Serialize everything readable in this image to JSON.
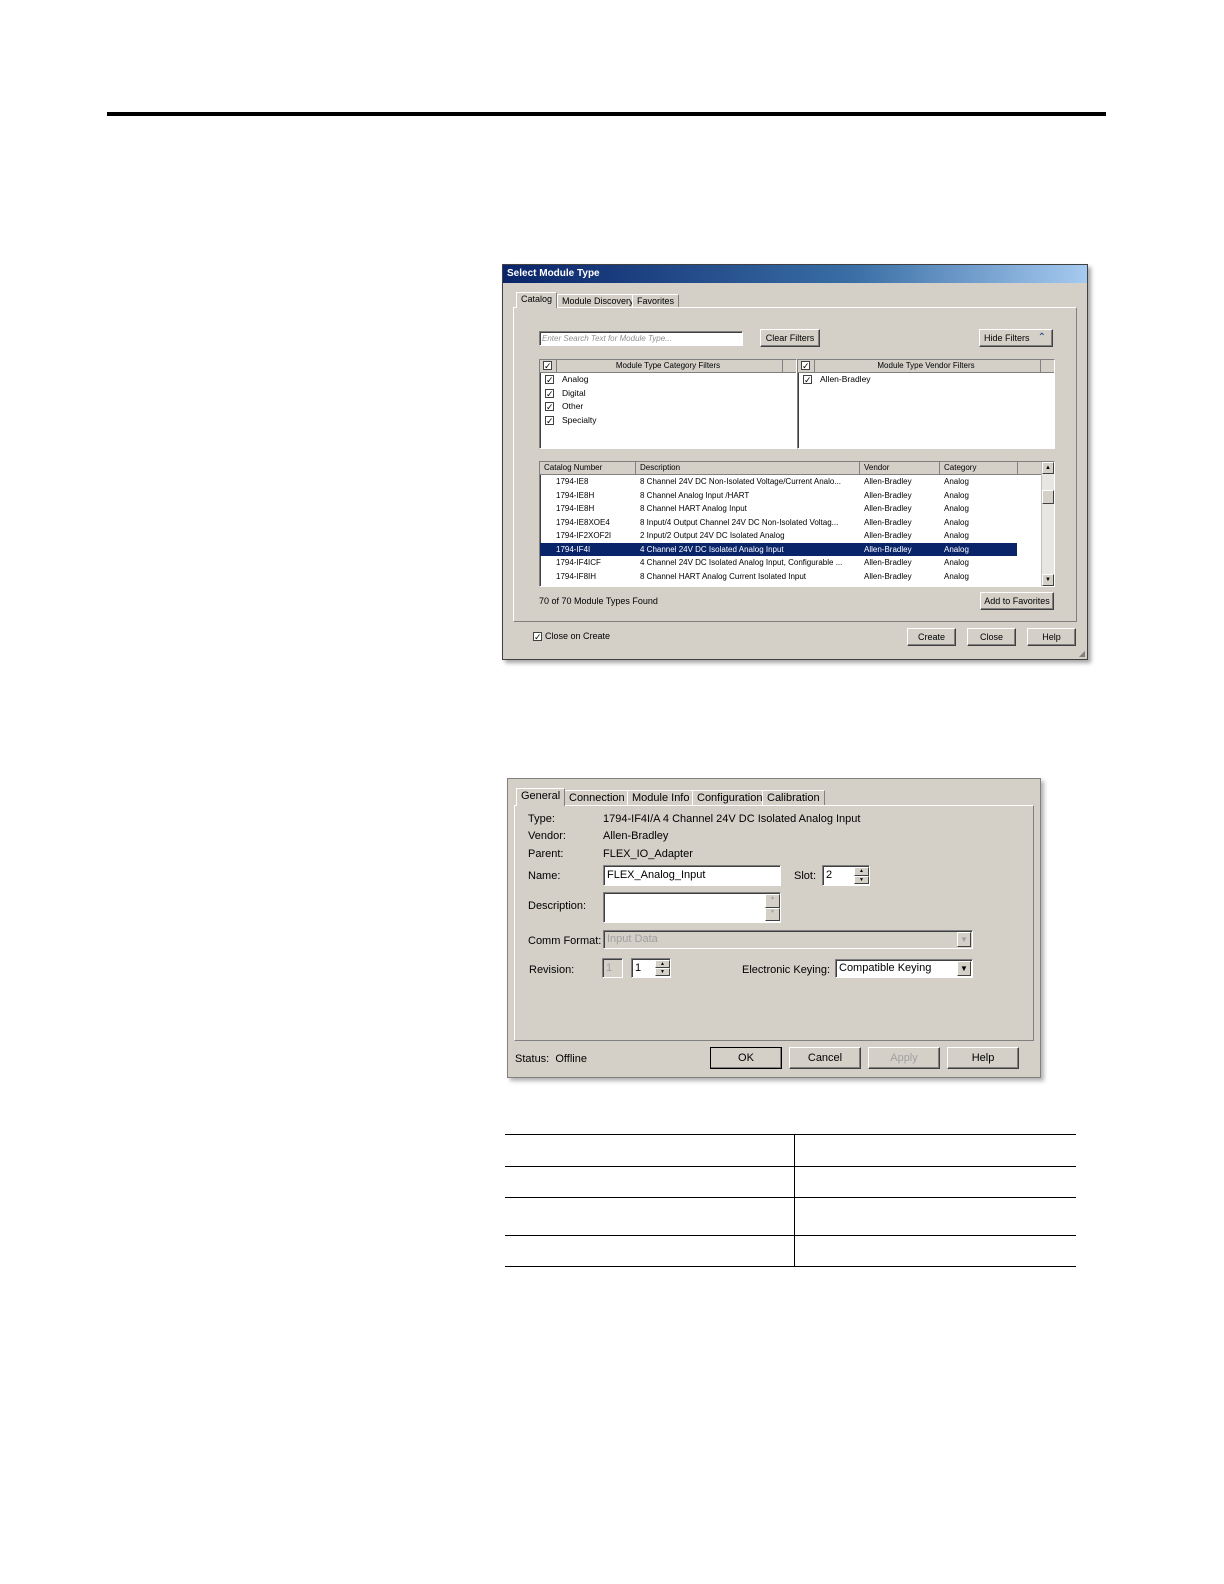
{
  "select_module_dialog": {
    "title": "Select Module Type",
    "tabs": [
      "Catalog",
      "Module Discovery",
      "Favorites"
    ],
    "search": {
      "placeholder": "Enter Search Text for Module Type..."
    },
    "clear_filters_label": "Clear Filters",
    "hide_filters_label": "Hide Filters",
    "category_filters": {
      "header": "Module Type Category Filters",
      "all_checked": true,
      "items": [
        {
          "label": "Analog",
          "checked": true
        },
        {
          "label": "Digital",
          "checked": true
        },
        {
          "label": "Other",
          "checked": true
        },
        {
          "label": "Specialty",
          "checked": true
        }
      ]
    },
    "vendor_filters": {
      "header": "Module Type Vendor Filters",
      "all_checked": true,
      "items": [
        {
          "label": "Allen-Bradley",
          "checked": true
        }
      ]
    },
    "columns": [
      "Catalog Number",
      "Description",
      "Vendor",
      "Category"
    ],
    "rows": [
      {
        "catalog": "1794-IE8",
        "description": "8 Channel 24V DC Non-Isolated Voltage/Current Analo...",
        "vendor": "Allen-Bradley",
        "category": "Analog"
      },
      {
        "catalog": "1794-IE8H",
        "description": "8 Channel Analog Input /HART",
        "vendor": "Allen-Bradley",
        "category": "Analog"
      },
      {
        "catalog": "1794-IE8H",
        "description": "8 Channel HART Analog Input",
        "vendor": "Allen-Bradley",
        "category": "Analog"
      },
      {
        "catalog": "1794-IE8XOE4",
        "description": "8 Input/4 Output Channel 24V DC Non-Isolated Voltag...",
        "vendor": "Allen-Bradley",
        "category": "Analog"
      },
      {
        "catalog": "1794-IF2XOF2I",
        "description": "2 Input/2 Output 24V DC Isolated Analog",
        "vendor": "Allen-Bradley",
        "category": "Analog"
      },
      {
        "catalog": "1794-IF4I",
        "description": "4 Channel 24V DC Isolated Analog Input",
        "vendor": "Allen-Bradley",
        "category": "Analog",
        "selected": true
      },
      {
        "catalog": "1794-IF4ICF",
        "description": "4 Channel 24V DC Isolated Analog Input, Configurable ...",
        "vendor": "Allen-Bradley",
        "category": "Analog"
      },
      {
        "catalog": "1794-IF8IH",
        "description": "8 Channel HART Analog Current Isolated Input",
        "vendor": "Allen-Bradley",
        "category": "Analog"
      }
    ],
    "found_text": "70  of 70 Module Types Found",
    "add_favorites_label": "Add to Favorites",
    "close_on_create": {
      "label": "Close on Create",
      "checked": true
    },
    "buttons": {
      "create": "Create",
      "close": "Close",
      "help": "Help"
    }
  },
  "properties_dialog": {
    "tabs": [
      "General",
      "Connection",
      "Module Info",
      "Configuration",
      "Calibration"
    ],
    "type_label": "Type:",
    "type_value": "1794-IF4I/A 4 Channel 24V DC Isolated Analog Input",
    "vendor_label": "Vendor:",
    "vendor_value": "Allen-Bradley",
    "parent_label": "Parent:",
    "parent_value": "FLEX_IO_Adapter",
    "name_label": "Name:",
    "name_value": "FLEX_Analog_Input",
    "slot_label": "Slot:",
    "slot_value": "2",
    "description_label": "Description:",
    "description_value": "",
    "comm_format_label": "Comm Format:",
    "comm_format_value": "Input Data",
    "revision_label": "Revision:",
    "revision_major": "1",
    "revision_minor": "1",
    "keying_label": "Electronic Keying:",
    "keying_value": "Compatible Keying",
    "status_label": "Status:",
    "status_value": "Offline",
    "buttons": {
      "ok": "OK",
      "cancel": "Cancel",
      "apply": "Apply",
      "help": "Help"
    }
  },
  "table": {
    "rows": 4
  }
}
